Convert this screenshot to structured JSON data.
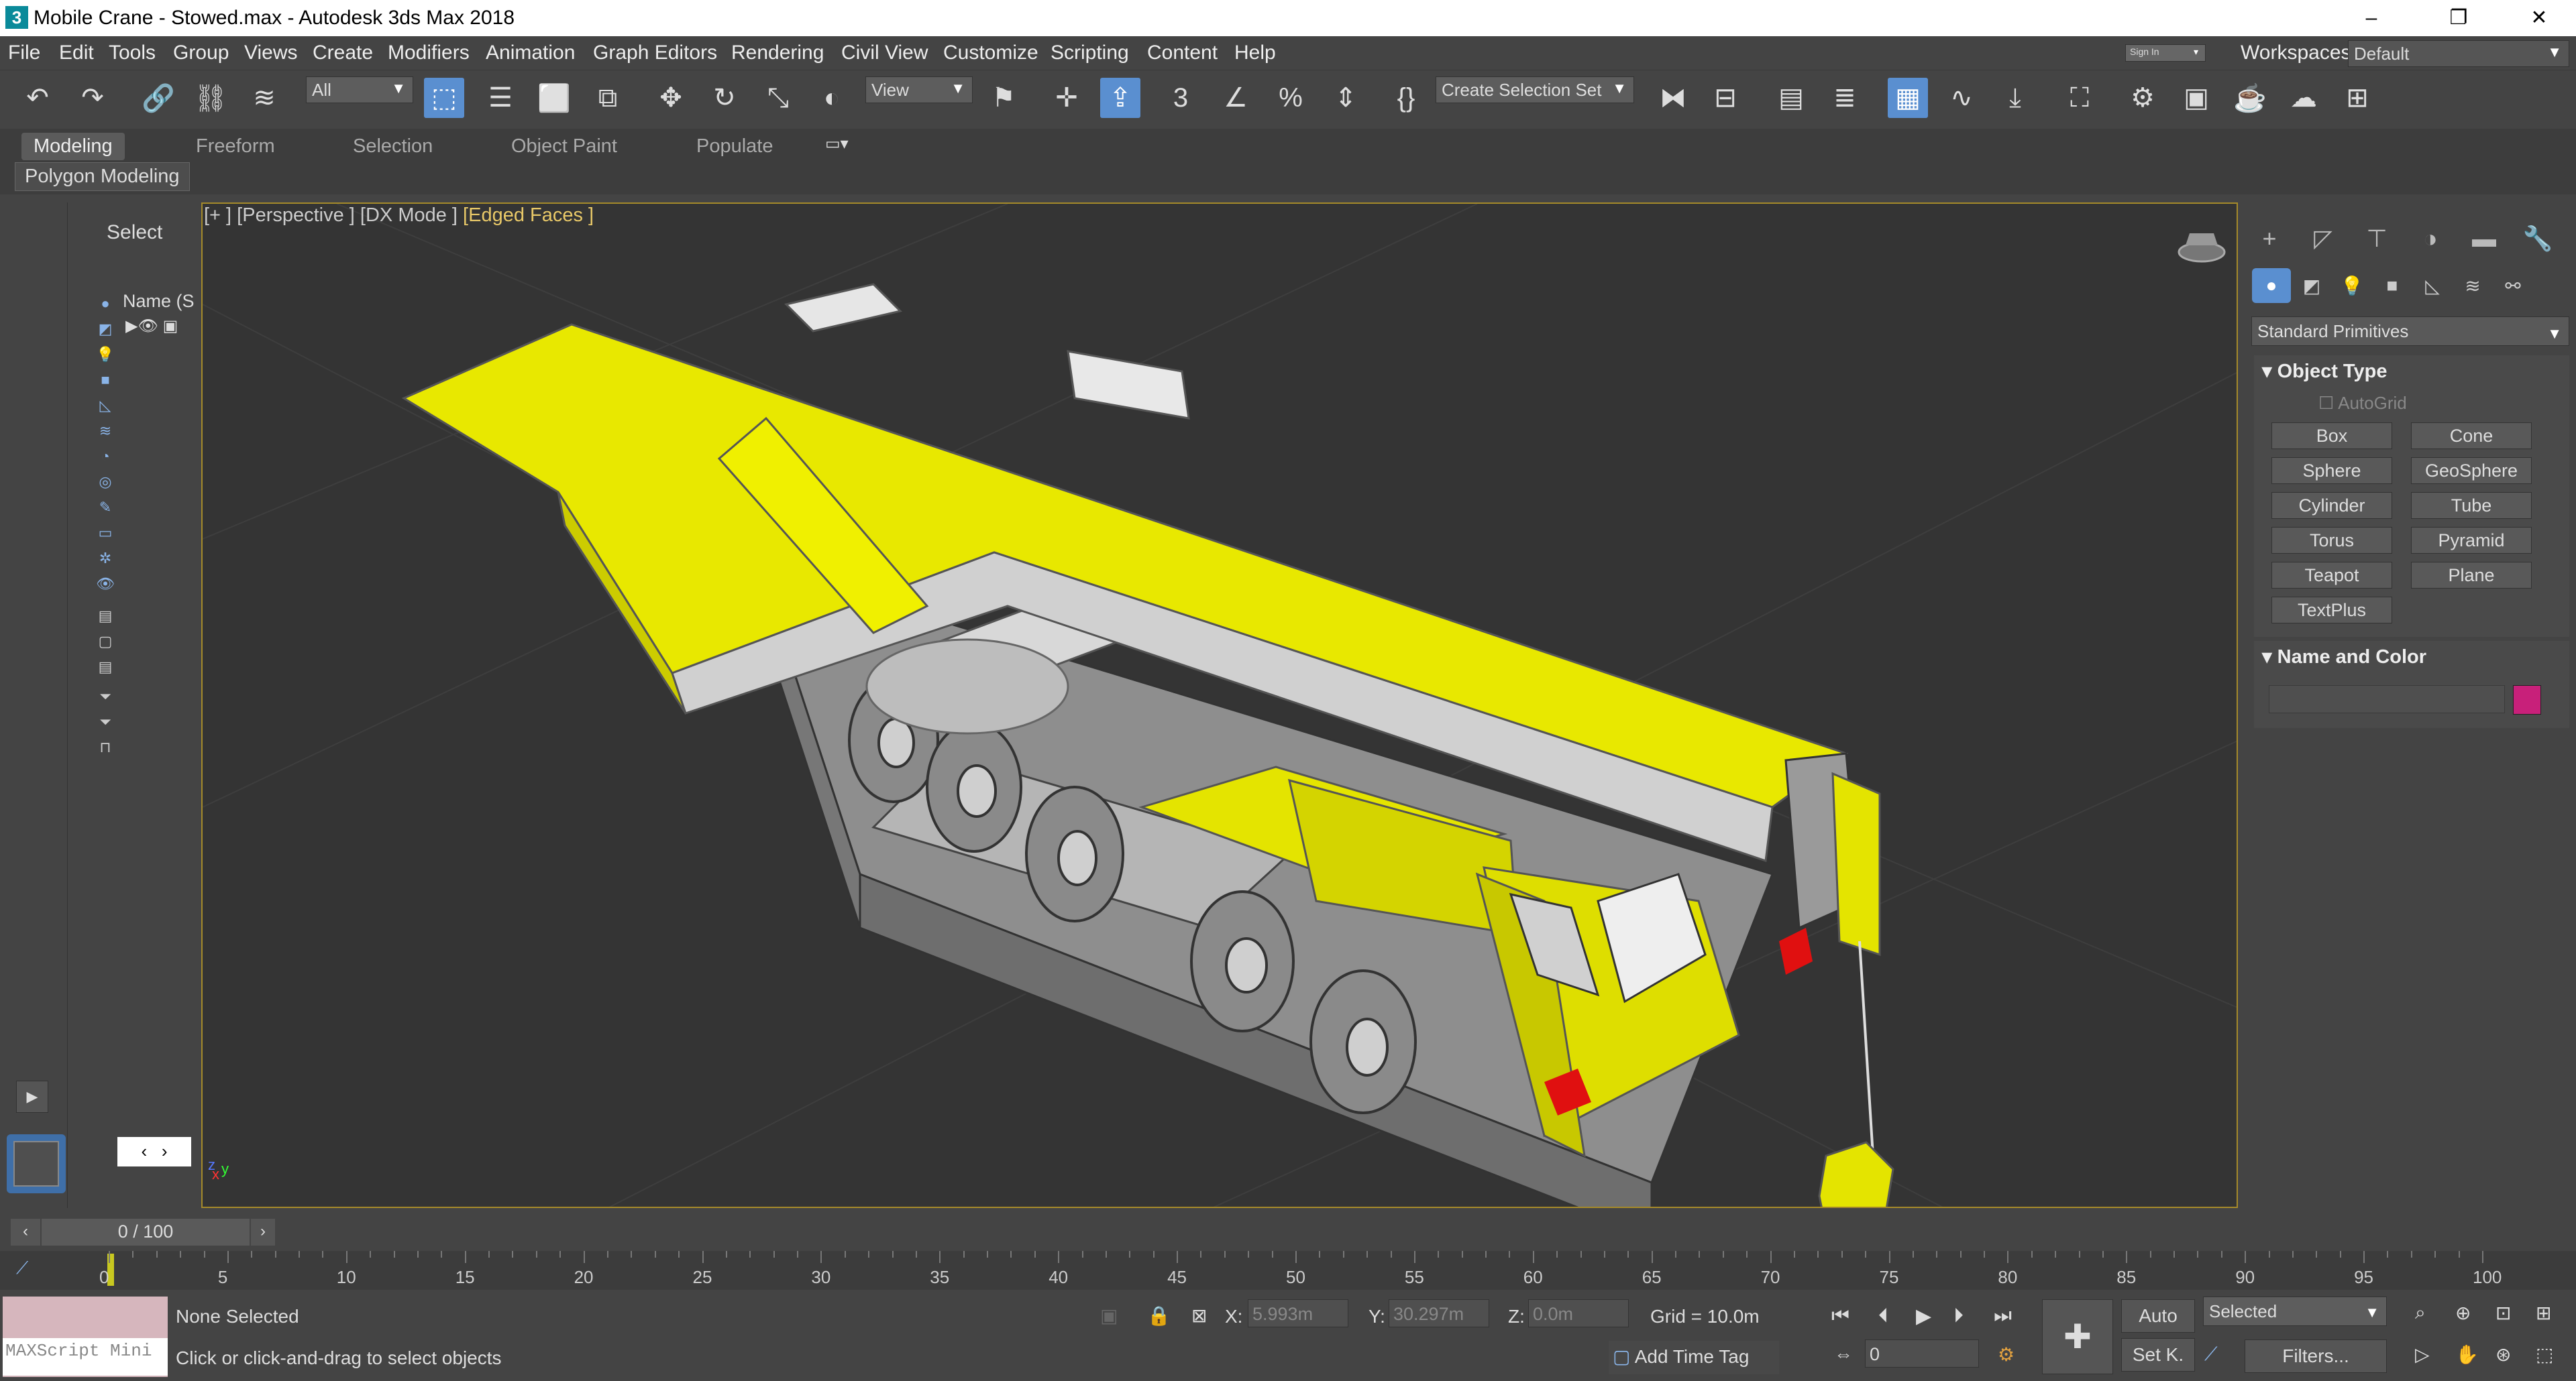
{
  "window": {
    "title": "Mobile Crane - Stowed.max - Autodesk 3ds Max 2018",
    "app_icon": "3",
    "workspaces_label": "Workspaces:",
    "workspace_value": "Default",
    "sign_in": "Sign In"
  },
  "menu": [
    "File",
    "Edit",
    "Tools",
    "Group",
    "Views",
    "Create",
    "Modifiers",
    "Animation",
    "Graph Editors",
    "Rendering",
    "Civil View",
    "Customize",
    "Scripting",
    "Content",
    "Help"
  ],
  "toolbar": {
    "filter_value": "All",
    "ref_coord": "View",
    "selection_set": "Create Selection Set"
  },
  "ribbon": {
    "tabs": [
      "Modeling",
      "Freeform",
      "Selection",
      "Object Paint",
      "Populate"
    ],
    "active_tab": "Modeling",
    "panel_label": "Polygon Modeling"
  },
  "scene_explorer": {
    "select_label": "Select",
    "name_header": "Name (S"
  },
  "viewport": {
    "label_plus": "[+ ]",
    "label_view": "[Perspective ]",
    "label_mode": "[DX Mode ]",
    "label_shading": "[Edged Faces ]",
    "axis_x": "x",
    "axis_y": "y",
    "axis_z": "z"
  },
  "command_panel": {
    "category": "Standard Primitives",
    "object_type_header": "Object Type",
    "autogrid": "AutoGrid",
    "buttons": [
      "Box",
      "Cone",
      "Sphere",
      "GeoSphere",
      "Cylinder",
      "Tube",
      "Torus",
      "Pyramid",
      "Teapot",
      "Plane",
      "TextPlus"
    ],
    "name_color_header": "Name and Color",
    "name_value": "",
    "color": "#c8207a"
  },
  "timeline": {
    "frame_display": "0 / 100",
    "ticks": [
      "0",
      "5",
      "10",
      "15",
      "20",
      "25",
      "30",
      "35",
      "40",
      "45",
      "50",
      "55",
      "60",
      "65",
      "70",
      "75",
      "80",
      "85",
      "90",
      "95",
      "100"
    ]
  },
  "status": {
    "maxscript": "MAXScript Mini",
    "selection": "None Selected",
    "prompt": "Click or click-and-drag to select objects",
    "x_label": "X:",
    "x_value": "5.993m",
    "y_label": "Y:",
    "y_value": "30.297m",
    "z_label": "Z:",
    "z_value": "0.0m",
    "grid": "Grid = 10.0m",
    "add_time_tag": "Add Time Tag",
    "auto": "Auto",
    "set_key": "Set K.",
    "key_mode": "Selected",
    "filters": "Filters...",
    "frame": "0"
  },
  "colors": {
    "crane_body": "#e8e800",
    "chassis": "#9a9a9a",
    "viewport_bg": "#343434",
    "accent": "#5a8fd0"
  }
}
